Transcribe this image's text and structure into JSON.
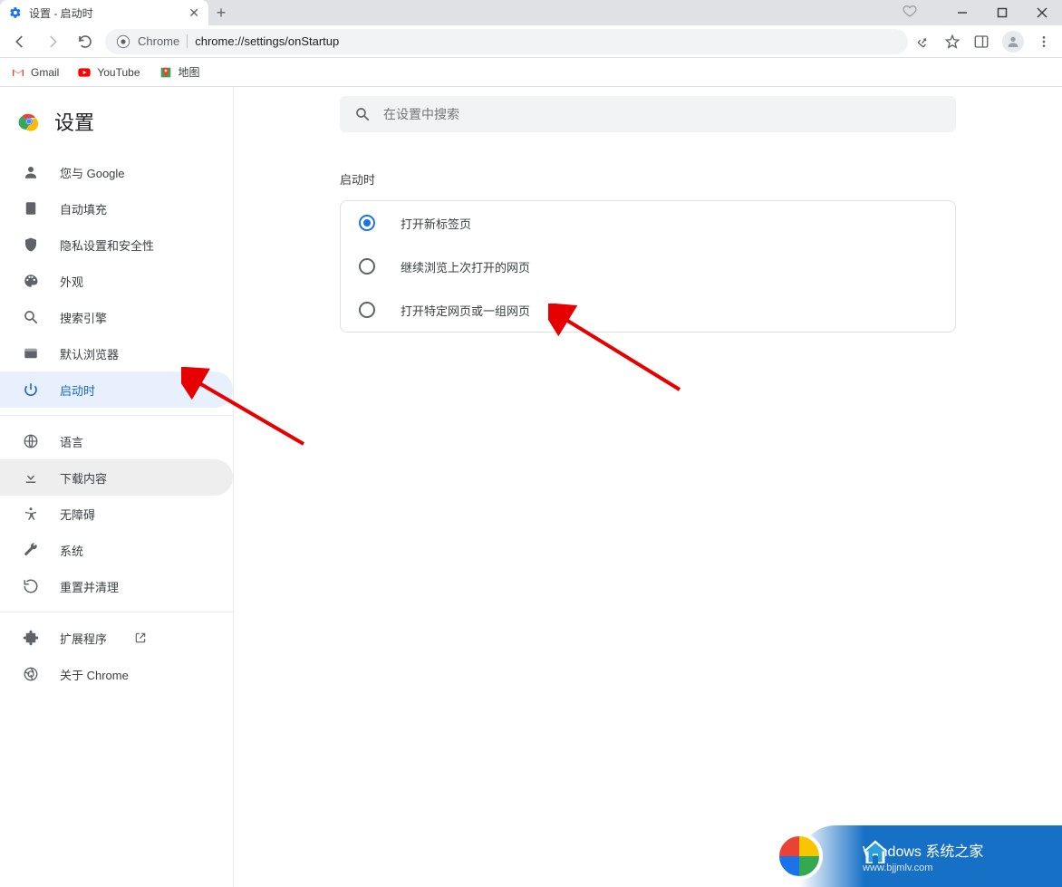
{
  "tab": {
    "title": "设置 - 启动时"
  },
  "omnibox": {
    "chip": "Chrome",
    "url_prefix": "chrome://",
    "url_bold": "settings",
    "url_suffix": "/onStartup"
  },
  "bookmarks": [
    {
      "label": "Gmail"
    },
    {
      "label": "YouTube"
    },
    {
      "label": "地图"
    }
  ],
  "sidebar": {
    "title": "设置",
    "items": [
      {
        "label": "您与 Google"
      },
      {
        "label": "自动填充"
      },
      {
        "label": "隐私设置和安全性"
      },
      {
        "label": "外观"
      },
      {
        "label": "搜索引擎"
      },
      {
        "label": "默认浏览器"
      },
      {
        "label": "启动时"
      }
    ],
    "items2": [
      {
        "label": "语言"
      },
      {
        "label": "下载内容"
      },
      {
        "label": "无障碍"
      },
      {
        "label": "系统"
      },
      {
        "label": "重置并清理"
      }
    ],
    "items3": [
      {
        "label": "扩展程序"
      },
      {
        "label": "关于 Chrome"
      }
    ]
  },
  "main": {
    "search_placeholder": "在设置中搜索",
    "section_title": "启动时",
    "options": [
      {
        "label": "打开新标签页",
        "checked": true
      },
      {
        "label": "继续浏览上次打开的网页",
        "checked": false
      },
      {
        "label": "打开特定网页或一组网页",
        "checked": false
      }
    ]
  },
  "watermark": {
    "title": "Windows 系统之家",
    "sub": "www.bjjmlv.com"
  }
}
